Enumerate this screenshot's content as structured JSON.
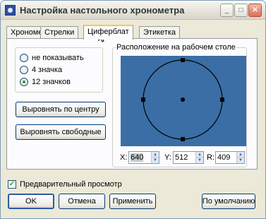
{
  "window": {
    "title": "Настройка настольного хронометра",
    "minimize_label": "_",
    "maximize_label": "□",
    "close_label": "✕"
  },
  "tabs": [
    {
      "label": "Хронометр",
      "active": false
    },
    {
      "label": "Стрелки",
      "active": false
    },
    {
      "label": "Циферблат",
      "active": true
    },
    {
      "label": "Этикетка",
      "active": false
    }
  ],
  "marks_options": [
    {
      "label": "не показывать",
      "checked": false
    },
    {
      "label": "4 значка",
      "checked": false
    },
    {
      "label": "12 значков",
      "checked": true
    }
  ],
  "buttons": {
    "center": "Выровнять по центру",
    "free": "Выровнять свободные",
    "ok": "OK",
    "cancel": "Отмена",
    "apply": "Применить",
    "default": "По умолчанию"
  },
  "position": {
    "legend": "Расположение на рабочем столе",
    "desktop_color": "#3a6ea5",
    "x_label": "X:",
    "x_value": "640",
    "y_label": "Y:",
    "y_value": "512",
    "r_label": "R:",
    "r_value": "409"
  },
  "preview": {
    "label": "Предварительный просмотр",
    "checked": true,
    "check_glyph": "✓"
  }
}
